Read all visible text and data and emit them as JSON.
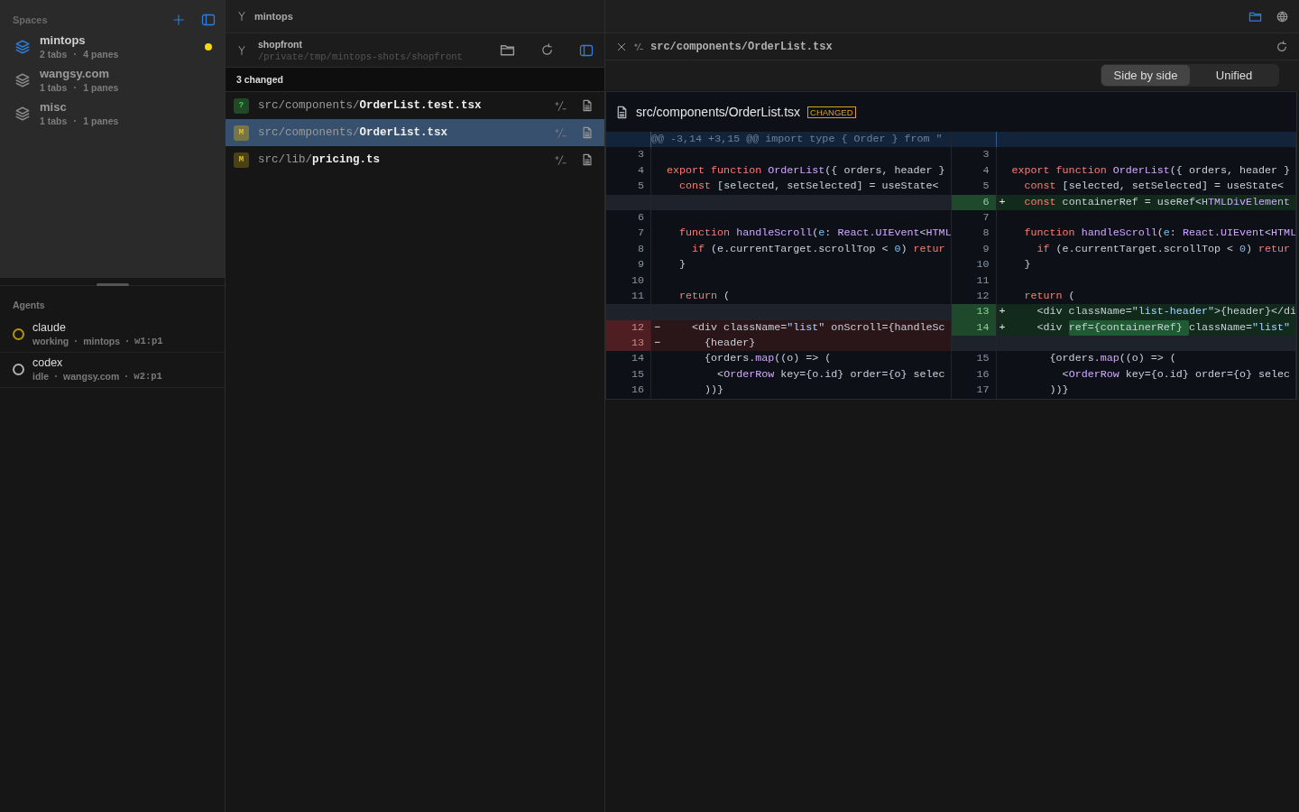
{
  "sidebar": {
    "title": "Spaces",
    "spaces": [
      {
        "name": "mintops",
        "tabs": "2 tabs",
        "panes": "4 panes",
        "selected": true,
        "busy": true
      },
      {
        "name": "wangsy.com",
        "tabs": "1 tabs",
        "panes": "1 panes",
        "selected": false,
        "busy": false
      },
      {
        "name": "misc",
        "tabs": "1 tabs",
        "panes": "1 panes",
        "selected": false,
        "busy": false
      }
    ],
    "agents_title": "Agents",
    "agents": [
      {
        "name": "claude",
        "status": "working",
        "space": "mintops",
        "pane": "w1:p1",
        "color": "#b8960a"
      },
      {
        "name": "codex",
        "status": "idle",
        "space": "wangsy.com",
        "pane": "w2:p1",
        "color": "#b0b0b0"
      }
    ]
  },
  "changes": {
    "workspace": "mintops",
    "repo": "shopfront",
    "path": "/private/tmp/mintops-shots/shopfront",
    "count": "3 changed",
    "files": [
      {
        "status": "?",
        "kind": "untracked",
        "dir": "src/components/",
        "name": "OrderList.test.tsx",
        "selected": false
      },
      {
        "status": "M",
        "kind": "modified",
        "dir": "src/components/",
        "name": "OrderList.tsx",
        "selected": true
      },
      {
        "status": "M",
        "kind": "modified",
        "dir": "src/lib/",
        "name": "pricing.ts",
        "selected": false
      }
    ]
  },
  "diff": {
    "tab_path": "src/components/OrderList.tsx",
    "modes": [
      {
        "label": "Side by side",
        "selected": true
      },
      {
        "label": "Unified",
        "selected": false
      }
    ],
    "file": "src/components/OrderList.tsx",
    "badge": "CHANGED",
    "hunk": "@@ -3,14 +3,15 @@ import type { Order } from \"",
    "rows": [
      {
        "left": {
          "number": "3",
          "kind": "context"
        },
        "right": {
          "number": "3",
          "kind": "context"
        }
      },
      {
        "left": {
          "number": "4",
          "kind": "context",
          "tokens": [
            {
              "kind": "keyword",
              "text": "export function "
            },
            {
              "kind": "function",
              "text": "OrderList"
            },
            {
              "kind": "plain",
              "text": "({ orders, header }"
            }
          ]
        },
        "right": {
          "number": "4",
          "kind": "context",
          "tokens": [
            {
              "kind": "keyword",
              "text": "export function "
            },
            {
              "kind": "function",
              "text": "OrderList"
            },
            {
              "kind": "plain",
              "text": "({ orders, header }"
            }
          ]
        }
      },
      {
        "left": {
          "number": "5",
          "kind": "context",
          "tokens": [
            {
              "kind": "keyword",
              "text": "  const"
            },
            {
              "kind": "plain",
              "text": " [selected, setSelected] = useState<"
            }
          ]
        },
        "right": {
          "number": "5",
          "kind": "context",
          "tokens": [
            {
              "kind": "keyword",
              "text": "  const"
            },
            {
              "kind": "plain",
              "text": " [selected, setSelected] = useState<"
            }
          ]
        }
      },
      {
        "left": {
          "kind": "filler"
        },
        "right": {
          "number": "6",
          "kind": "added",
          "sign": "+",
          "tokens": [
            {
              "kind": "keyword",
              "text": "  const"
            },
            {
              "kind": "plain",
              "text": " containerRef = useRef<"
            },
            {
              "kind": "function",
              "text": "HTMLDivElement"
            }
          ]
        }
      },
      {
        "left": {
          "number": "6",
          "kind": "context"
        },
        "right": {
          "number": "7",
          "kind": "context"
        }
      },
      {
        "left": {
          "number": "7",
          "kind": "context",
          "tokens": [
            {
              "kind": "keyword",
              "text": "  function "
            },
            {
              "kind": "function",
              "text": "handleScroll"
            },
            {
              "kind": "plain",
              "text": "("
            },
            {
              "kind": "number",
              "text": "e"
            },
            {
              "kind": "plain",
              "text": ": "
            },
            {
              "kind": "function",
              "text": "React.UIEvent"
            },
            {
              "kind": "plain",
              "text": "<"
            },
            {
              "kind": "function",
              "text": "HTML"
            }
          ]
        },
        "right": {
          "number": "8",
          "kind": "context",
          "tokens": [
            {
              "kind": "keyword",
              "text": "  function "
            },
            {
              "kind": "function",
              "text": "handleScroll"
            },
            {
              "kind": "plain",
              "text": "("
            },
            {
              "kind": "number",
              "text": "e"
            },
            {
              "kind": "plain",
              "text": ": "
            },
            {
              "kind": "function",
              "text": "React.UIEvent"
            },
            {
              "kind": "plain",
              "text": "<"
            },
            {
              "kind": "function",
              "text": "HTML"
            }
          ]
        }
      },
      {
        "left": {
          "number": "8",
          "kind": "context",
          "tokens": [
            {
              "kind": "keyword",
              "text": "    if"
            },
            {
              "kind": "plain",
              "text": " (e.currentTarget.scrollTop < "
            },
            {
              "kind": "number",
              "text": "0"
            },
            {
              "kind": "plain",
              "text": ") "
            },
            {
              "kind": "keyword",
              "text": "retur"
            }
          ]
        },
        "right": {
          "number": "9",
          "kind": "context",
          "tokens": [
            {
              "kind": "keyword",
              "text": "    if"
            },
            {
              "kind": "plain",
              "text": " (e.currentTarget.scrollTop < "
            },
            {
              "kind": "number",
              "text": "0"
            },
            {
              "kind": "plain",
              "text": ") "
            },
            {
              "kind": "keyword",
              "text": "retur"
            }
          ]
        }
      },
      {
        "left": {
          "number": "9",
          "kind": "context",
          "tokens": [
            {
              "kind": "plain",
              "text": "  }"
            }
          ]
        },
        "right": {
          "number": "10",
          "kind": "context",
          "tokens": [
            {
              "kind": "plain",
              "text": "  }"
            }
          ]
        }
      },
      {
        "left": {
          "number": "10",
          "kind": "context"
        },
        "right": {
          "number": "11",
          "kind": "context"
        }
      },
      {
        "left": {
          "number": "11",
          "kind": "context",
          "tokens": [
            {
              "kind": "keyword",
              "text": "  return"
            },
            {
              "kind": "plain",
              "text": " ("
            }
          ]
        },
        "right": {
          "number": "12",
          "kind": "context",
          "tokens": [
            {
              "kind": "keyword",
              "text": "  return"
            },
            {
              "kind": "plain",
              "text": " ("
            }
          ]
        }
      },
      {
        "left": {
          "kind": "filler"
        },
        "right": {
          "number": "13",
          "kind": "added",
          "sign": "+",
          "tokens": [
            {
              "kind": "plain",
              "text": "    <div className="
            },
            {
              "kind": "string",
              "text": "\"list-header\""
            },
            {
              "kind": "plain",
              "text": ">{header}</di"
            }
          ]
        }
      },
      {
        "left": {
          "number": "12",
          "kind": "removed",
          "sign": "−",
          "tokens": [
            {
              "kind": "plain",
              "text": "    <div className="
            },
            {
              "kind": "string",
              "text": "\"list\""
            },
            {
              "kind": "plain",
              "text": " onScroll={handleSc"
            }
          ]
        },
        "right": {
          "number": "14",
          "kind": "added",
          "sign": "+",
          "tokens": [
            {
              "kind": "plain",
              "text": "    <div "
            },
            {
              "kind": "highlight",
              "text": "ref={containerRef} "
            },
            {
              "kind": "plain",
              "text": "className="
            },
            {
              "kind": "string",
              "text": "\"list\""
            }
          ]
        }
      },
      {
        "left": {
          "number": "13",
          "kind": "removed",
          "sign": "−",
          "tokens": [
            {
              "kind": "plain",
              "text": "      {header}"
            }
          ]
        },
        "right": {
          "kind": "filler"
        }
      },
      {
        "left": {
          "number": "14",
          "kind": "context",
          "tokens": [
            {
              "kind": "plain",
              "text": "      {orders."
            },
            {
              "kind": "function",
              "text": "map"
            },
            {
              "kind": "plain",
              "text": "((o) => ("
            }
          ]
        },
        "right": {
          "number": "15",
          "kind": "context",
          "tokens": [
            {
              "kind": "plain",
              "text": "      {orders."
            },
            {
              "kind": "function",
              "text": "map"
            },
            {
              "kind": "plain",
              "text": "((o) => ("
            }
          ]
        }
      },
      {
        "left": {
          "number": "15",
          "kind": "context",
          "tokens": [
            {
              "kind": "plain",
              "text": "        <"
            },
            {
              "kind": "function",
              "text": "OrderRow"
            },
            {
              "kind": "plain",
              "text": " key={o.id} order={o} selec"
            }
          ]
        },
        "right": {
          "number": "16",
          "kind": "context",
          "tokens": [
            {
              "kind": "plain",
              "text": "        <"
            },
            {
              "kind": "function",
              "text": "OrderRow"
            },
            {
              "kind": "plain",
              "text": " key={o.id} order={o} selec"
            }
          ]
        }
      },
      {
        "left": {
          "number": "16",
          "kind": "context",
          "tokens": [
            {
              "kind": "plain",
              "text": "      ))}"
            }
          ]
        },
        "right": {
          "number": "17",
          "kind": "context",
          "tokens": [
            {
              "kind": "plain",
              "text": "      ))}"
            }
          ]
        }
      }
    ]
  }
}
